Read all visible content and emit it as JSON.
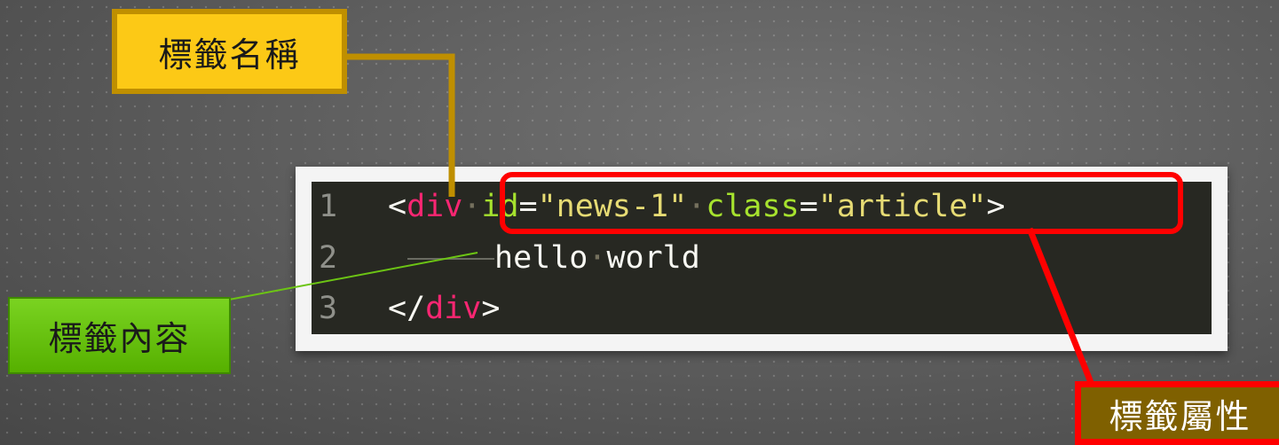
{
  "code": {
    "line_numbers": [
      "1",
      "2",
      "3"
    ],
    "line1": {
      "open": "<",
      "tag": "div",
      "ws1": "·",
      "attr1_name": "id",
      "eq1": "=",
      "attr1_value": "\"news-1\"",
      "ws2": "·",
      "attr2_name": "class",
      "eq2": "=",
      "attr2_value": "\"article\"",
      "close": ">"
    },
    "line2": {
      "word1": "hello",
      "ws": "·",
      "word2": "world"
    },
    "line3": {
      "open": "</",
      "tag": "div",
      "close": ">"
    }
  },
  "callouts": {
    "tag_name": "標籤名稱",
    "tag_content": "標籤內容",
    "tag_attributes": "標籤屬性"
  },
  "colors": {
    "tag_name_fill": "#fcc916",
    "tag_name_border": "#bf8f00",
    "tag_content_fill": "#6cc414",
    "tag_attributes_fill": "#7f6000",
    "highlight": "#ff0000"
  }
}
